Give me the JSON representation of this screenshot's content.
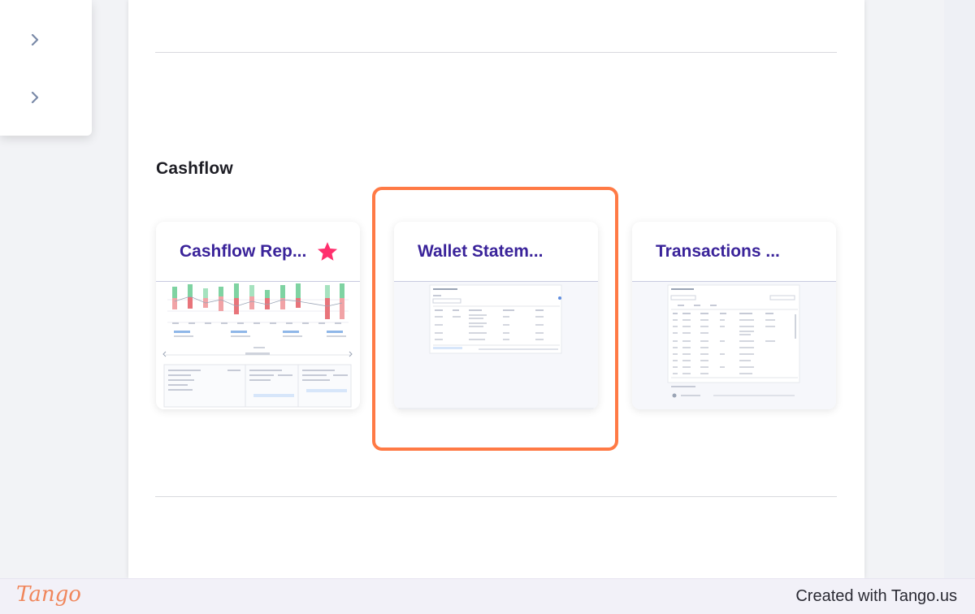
{
  "sidebar": {
    "items": [
      {
        "icon": "chevron-right-icon"
      },
      {
        "icon": "chevron-right-icon"
      }
    ]
  },
  "section": {
    "title": "Cashflow"
  },
  "reports": [
    {
      "title": "Cashflow Rep...",
      "favorite": true,
      "thumbnail": "cashflow-report-preview"
    },
    {
      "title": "Wallet Statem...",
      "favorite": false,
      "thumbnail": "wallet-statement-preview",
      "highlighted": true
    },
    {
      "title": "Transactions ...",
      "favorite": false,
      "thumbnail": "transactions-report-preview"
    }
  ],
  "colors": {
    "card_title": "#3a239a",
    "star": "#ff2f6d",
    "highlight": "#ff7a45",
    "brand": "#f0865b",
    "chart_green": "#5cc18a",
    "chart_red": "#e8747a"
  },
  "footer": {
    "brand": "Tango",
    "credit": "Created with Tango.us"
  }
}
